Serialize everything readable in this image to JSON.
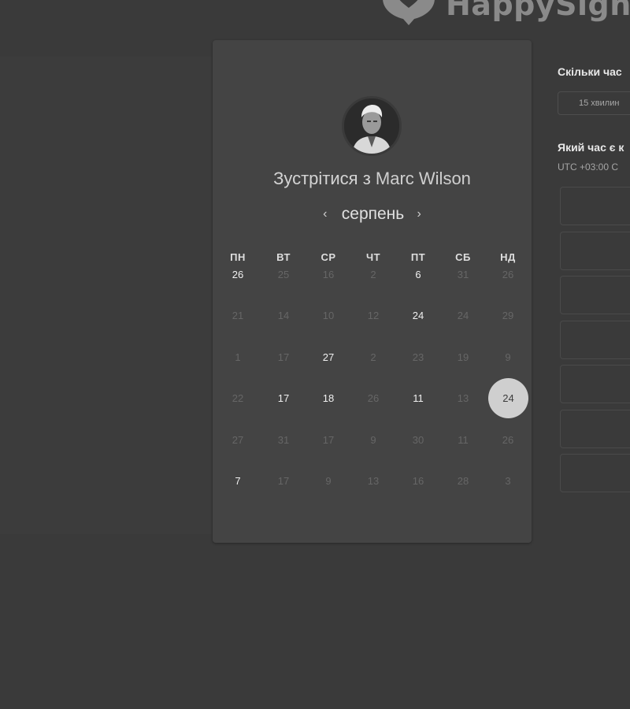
{
  "brand": {
    "name": "HappySign"
  },
  "meeting": {
    "title_prefix": "Зустрітися з",
    "host_name": "Marc Wilson"
  },
  "calendar": {
    "month": "серпень",
    "prev_icon": "‹",
    "next_icon": "›",
    "weekdays": [
      "ПН",
      "ВТ",
      "СР",
      "ЧТ",
      "ПТ",
      "СБ",
      "НД"
    ],
    "weeks": [
      [
        {
          "d": "26",
          "a": true
        },
        {
          "d": "25",
          "a": false
        },
        {
          "d": "16",
          "a": false
        },
        {
          "d": "2",
          "a": false
        },
        {
          "d": "6",
          "a": true
        },
        {
          "d": "31",
          "a": false
        },
        {
          "d": "26",
          "a": false
        }
      ],
      [
        {
          "d": "21",
          "a": false
        },
        {
          "d": "14",
          "a": false
        },
        {
          "d": "10",
          "a": false
        },
        {
          "d": "12",
          "a": false
        },
        {
          "d": "24",
          "a": true
        },
        {
          "d": "24",
          "a": false
        },
        {
          "d": "29",
          "a": false
        }
      ],
      [
        {
          "d": "1",
          "a": false
        },
        {
          "d": "17",
          "a": false
        },
        {
          "d": "27",
          "a": true
        },
        {
          "d": "2",
          "a": false
        },
        {
          "d": "23",
          "a": false
        },
        {
          "d": "19",
          "a": false
        },
        {
          "d": "9",
          "a": false
        }
      ],
      [
        {
          "d": "22",
          "a": false
        },
        {
          "d": "17",
          "a": true
        },
        {
          "d": "18",
          "a": true
        },
        {
          "d": "26",
          "a": false
        },
        {
          "d": "11",
          "a": true
        },
        {
          "d": "13",
          "a": false
        },
        {
          "d": "24",
          "a": true,
          "selected": true
        }
      ],
      [
        {
          "d": "27",
          "a": false
        },
        {
          "d": "31",
          "a": false
        },
        {
          "d": "17",
          "a": false
        },
        {
          "d": "9",
          "a": false
        },
        {
          "d": "30",
          "a": false
        },
        {
          "d": "11",
          "a": false
        },
        {
          "d": "26",
          "a": false
        }
      ],
      [
        {
          "d": "7",
          "a": true
        },
        {
          "d": "17",
          "a": false
        },
        {
          "d": "9",
          "a": false
        },
        {
          "d": "13",
          "a": false
        },
        {
          "d": "16",
          "a": false
        },
        {
          "d": "28",
          "a": false
        },
        {
          "d": "3",
          "a": false
        }
      ]
    ]
  },
  "sidebar": {
    "duration_question": "Скільки час",
    "duration_value": "15 хвилин",
    "time_question": "Який час є к",
    "timezone": "UTC +03:00 C",
    "slot_count": 7
  },
  "colors": {
    "background": "#3a3a3a",
    "card": "#444444",
    "selected_day": "#cfcfcf"
  }
}
